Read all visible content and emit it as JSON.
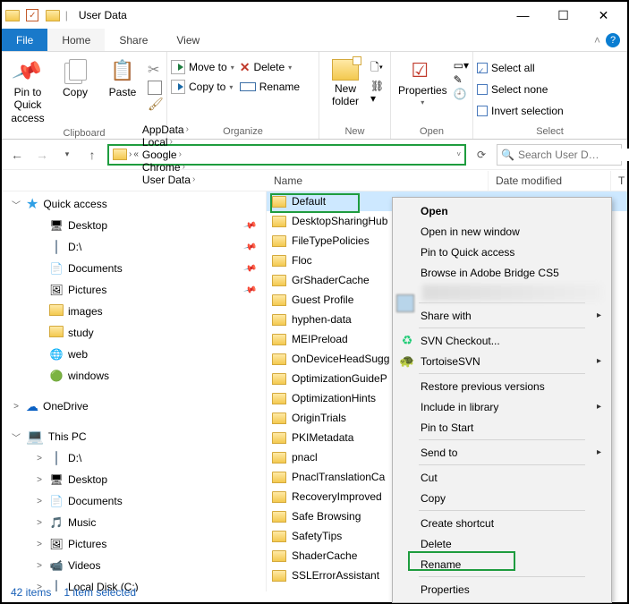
{
  "window": {
    "title": "User Data"
  },
  "tabs": {
    "file": "File",
    "home": "Home",
    "share": "Share",
    "view": "View"
  },
  "ribbon": {
    "clipboard": {
      "label": "Clipboard",
      "pin": "Pin to Quick\naccess",
      "copy": "Copy",
      "paste": "Paste"
    },
    "organize": {
      "label": "Organize",
      "moveto": "Move to",
      "copyto": "Copy to",
      "delete": "Delete",
      "rename": "Rename"
    },
    "new": {
      "label": "New",
      "newfolder": "New\nfolder"
    },
    "open": {
      "label": "Open",
      "properties": "Properties"
    },
    "select": {
      "label": "Select",
      "all": "Select all",
      "none": "Select none",
      "invert": "Invert selection"
    }
  },
  "breadcrumb": [
    "AppData",
    "Local",
    "Google",
    "Chrome",
    "User Data"
  ],
  "search": {
    "placeholder": "Search User D…"
  },
  "columns": {
    "name": "Name",
    "date": "Date modified",
    "type": "T"
  },
  "tree": {
    "quick": "Quick access",
    "quick_items": [
      "Desktop",
      "D:\\",
      "Documents",
      "Pictures",
      "images",
      "study",
      "web",
      "windows"
    ],
    "onedrive": "OneDrive",
    "thispc": "This PC",
    "pc_items": [
      "D:\\",
      "Desktop",
      "Documents",
      "Music",
      "Pictures",
      "Videos",
      "Local Disk (C:)"
    ]
  },
  "folders": [
    "Default",
    "DesktopSharingHub",
    "FileTypePolicies",
    "Floc",
    "GrShaderCache",
    "Guest Profile",
    "hyphen-data",
    "MEIPreload",
    "OnDeviceHeadSugg",
    "OptimizationGuideP",
    "OptimizationHints",
    "OriginTrials",
    "PKIMetadata",
    "pnacl",
    "PnaclTranslationCa",
    "RecoveryImproved",
    "Safe Browsing",
    "SafetyTips",
    "ShaderCache",
    "SSLErrorAssistant"
  ],
  "ctx": {
    "open": "Open",
    "openwin": "Open in new window",
    "pinq": "Pin to Quick access",
    "bridge": "Browse in Adobe Bridge CS5",
    "share": "Share with",
    "svn": "SVN Checkout...",
    "tsvn": "TortoiseSVN",
    "restore": "Restore previous versions",
    "lib": "Include in library",
    "pinstart": "Pin to Start",
    "sendto": "Send to",
    "cut": "Cut",
    "copy": "Copy",
    "shortcut": "Create shortcut",
    "delete": "Delete",
    "rename": "Rename",
    "props": "Properties"
  },
  "status": {
    "items": "42 items",
    "sel": "1 item selected"
  }
}
